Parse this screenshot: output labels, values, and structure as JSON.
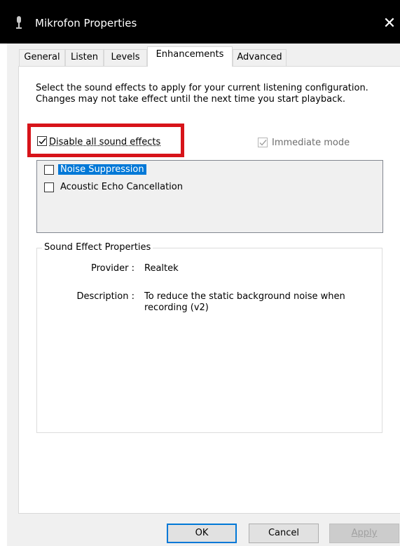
{
  "window": {
    "title": "Mikrofon Properties",
    "close_glyph": "✕",
    "icon": "microphone-icon"
  },
  "tabs": [
    {
      "label": "General",
      "active": false
    },
    {
      "label": "Listen",
      "active": false
    },
    {
      "label": "Levels",
      "active": false
    },
    {
      "label": "Enhancements",
      "active": true
    },
    {
      "label": "Advanced",
      "active": false
    }
  ],
  "enhancements": {
    "description": "Select the sound effects to apply for your current listening configuration. Changes may not take effect until the next time you start playback.",
    "disable_all": {
      "label": "Disable all sound effects",
      "checked": true
    },
    "immediate_mode": {
      "label": "Immediate mode",
      "checked": true,
      "enabled": false
    },
    "effects": [
      {
        "label": "Noise Suppression",
        "checked": false,
        "selected": true
      },
      {
        "label": "Acoustic Echo Cancellation",
        "checked": false,
        "selected": false
      }
    ],
    "properties": {
      "group_title": "Sound Effect Properties",
      "provider_label": "Provider :",
      "provider_value": "Realtek",
      "description_label": "Description :",
      "description_value": "To reduce the static background noise when recording (v2)"
    }
  },
  "buttons": {
    "ok": "OK",
    "cancel": "Cancel",
    "apply": "Apply"
  },
  "colors": {
    "highlight": "#d7141a",
    "selection": "#0078d7",
    "titlebar": "#000000"
  }
}
